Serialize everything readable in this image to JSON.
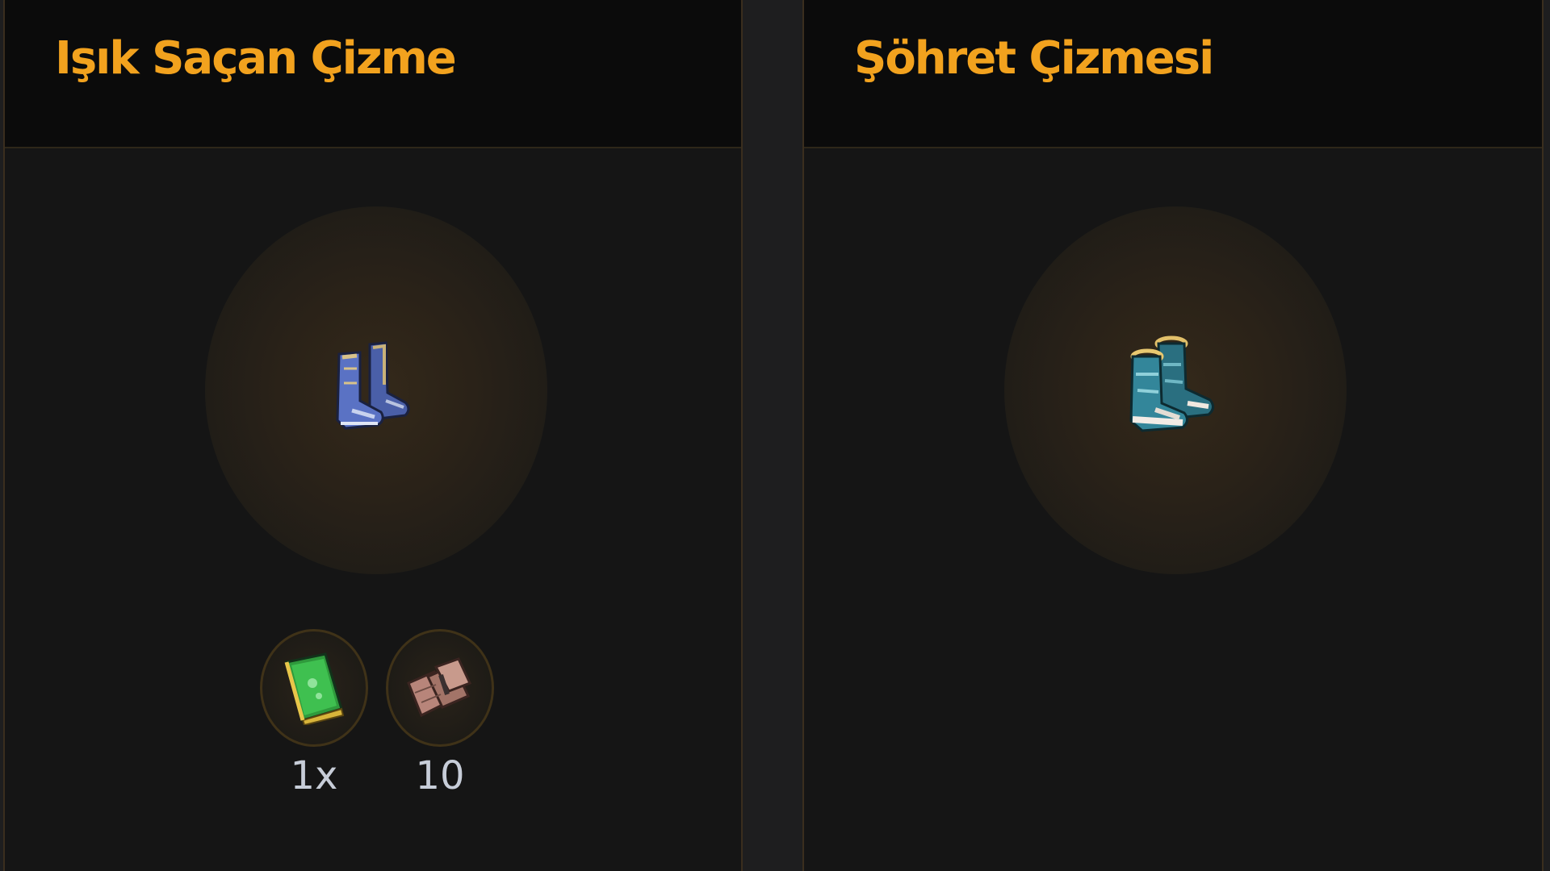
{
  "cards": [
    {
      "title": "Işık Saçan Çizme",
      "item_icon": "blue-boots-icon",
      "materials": [
        {
          "icon": "green-book-icon",
          "count": "1x"
        },
        {
          "icon": "stone-pile-icon",
          "count": "10"
        }
      ]
    },
    {
      "title": "Şöhret Çizmesi",
      "item_icon": "teal-boots-icon",
      "materials": []
    }
  ],
  "colors": {
    "title": "#f2a21e",
    "card_bg": "#151515",
    "header_bg": "#0b0b0b",
    "border": "#3a2e1e",
    "count_text": "#c7cdd8"
  }
}
